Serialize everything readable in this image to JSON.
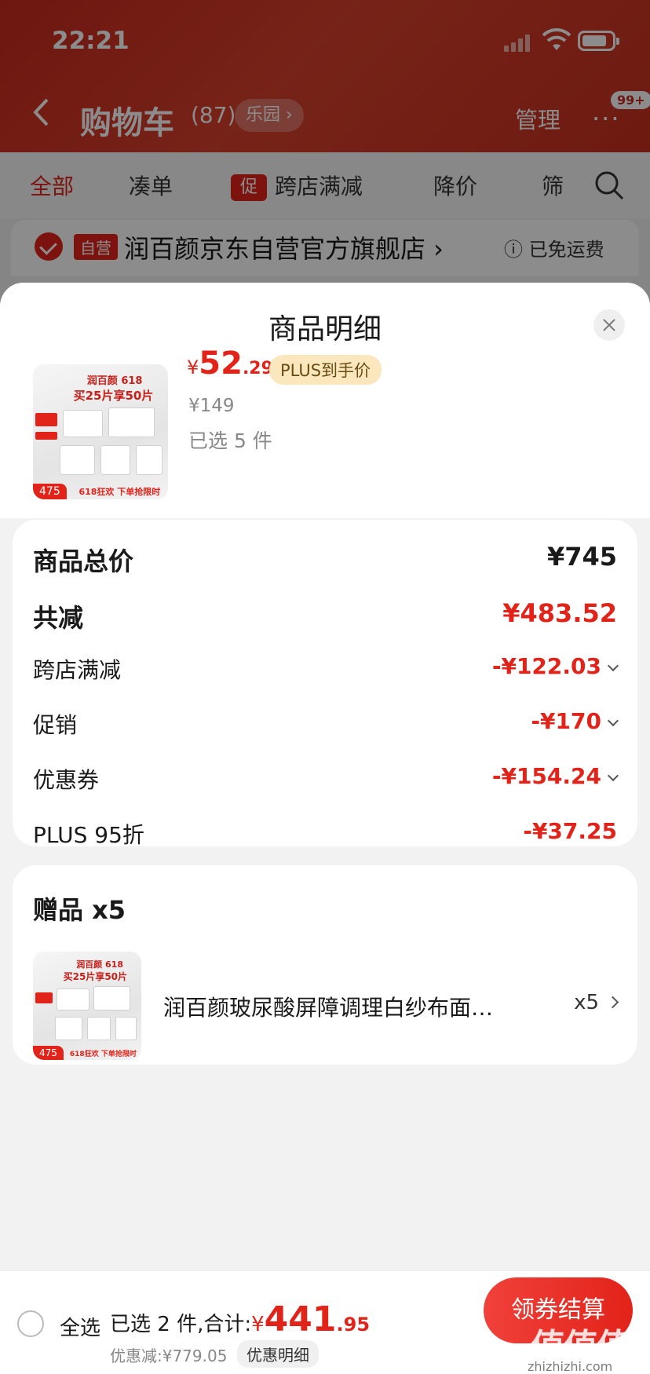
{
  "status_bar": {
    "time": "22:21"
  },
  "cart_header": {
    "title": "购物车",
    "count": "(87)",
    "pill": "乐园 ›",
    "manage": "管理",
    "more": "···",
    "badge": "99+"
  },
  "cart_tabs": {
    "all": "全部",
    "combine": "凑单",
    "promo_tag": "促",
    "cross_store": "跨店满减",
    "price_drop": "降价",
    "filter": "筛"
  },
  "store": {
    "tag": "自营",
    "name": "润百颜京东自营官方旗舰店 ›",
    "shipping": "ⓘ 已免运费"
  },
  "sheet": {
    "title": "商品明细",
    "product": {
      "currency": "¥",
      "price_int": "52",
      "price_dec": ".29",
      "plus_label": "PLUS到手价",
      "original_price": "¥149",
      "selected": "已选 5 件",
      "thumb": {
        "brand": "润百颜 618",
        "headline": "买25片享50片",
        "price_badge": "475",
        "band": "618狂欢 下单抢限时"
      }
    },
    "breakdown": {
      "total_label": "商品总价",
      "total_value": "¥745",
      "reduce_label": "共减",
      "reduce_value": "¥483.52",
      "cross_label": "跨店满减",
      "cross_value": "-¥122.03",
      "promo_label": "促销",
      "promo_value": "-¥170",
      "coupon_label": "优惠券",
      "coupon_value": "-¥154.24",
      "plus_label": "PLUS 95折",
      "plus_value": "-¥37.25"
    },
    "gift": {
      "title": "赠品 x5",
      "name": "润百颜玻尿酸屏障调理白纱布面…",
      "qty": "x5"
    }
  },
  "bottom_bar": {
    "select_all": "全选",
    "selected_prefix": "已选 2 件,合计:",
    "currency": "¥",
    "total_int": "441",
    "total_dec": ".95",
    "discount": "优惠减:¥779.05",
    "discount_btn": "优惠明细",
    "checkout": "领券结算"
  },
  "watermark": {
    "text": "值值值",
    "site": "zhizhizhi.com"
  },
  "colors": {
    "brand_red": "#e2231a",
    "plus_gold": "#fbe7bd"
  }
}
